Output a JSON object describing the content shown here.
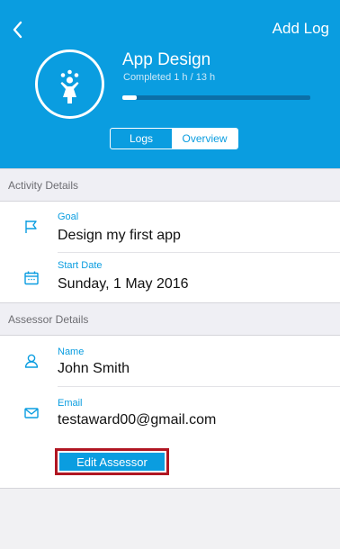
{
  "header": {
    "add_log_label": "Add Log",
    "activity_title": "App Design",
    "completed_text": "Completed 1 h / 13 h",
    "progress": {
      "completed_hours": 1,
      "total_hours": 13
    },
    "tabs": [
      {
        "label": "Logs",
        "selected": false
      },
      {
        "label": "Overview",
        "selected": true
      }
    ]
  },
  "activity_details": {
    "section_title": "Activity Details",
    "goal": {
      "label": "Goal",
      "value": "Design my first app",
      "icon": "flag-icon"
    },
    "start_date": {
      "label": "Start Date",
      "value": "Sunday, 1 May 2016",
      "icon": "calendar-icon"
    }
  },
  "assessor_details": {
    "section_title": "Assessor Details",
    "name": {
      "label": "Name",
      "value": "John Smith",
      "icon": "user-icon"
    },
    "email": {
      "label": "Email",
      "value": "testaward00@gmail.com",
      "icon": "mail-icon"
    },
    "edit_button_label": "Edit Assessor"
  },
  "colors": {
    "brand": "#0a9de0",
    "highlight": "#b01622"
  }
}
